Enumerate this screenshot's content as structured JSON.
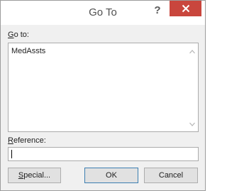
{
  "window": {
    "title": "Go To",
    "help_label": "?"
  },
  "goto": {
    "label_accel": "G",
    "label_rest": "o to:",
    "items": [
      "MedAssts"
    ]
  },
  "reference": {
    "label_accel": "R",
    "label_rest": "eference:",
    "value": ""
  },
  "buttons": {
    "special_accel": "S",
    "special_rest": "pecial...",
    "ok": "OK",
    "cancel": "Cancel"
  },
  "colors": {
    "close_button": "#c9463d",
    "dialog_bg": "#f0f0f0"
  },
  "icons": {
    "close": "close-icon",
    "scroll_up": "scroll-up-arrow-icon",
    "scroll_down": "scroll-down-arrow-icon"
  }
}
